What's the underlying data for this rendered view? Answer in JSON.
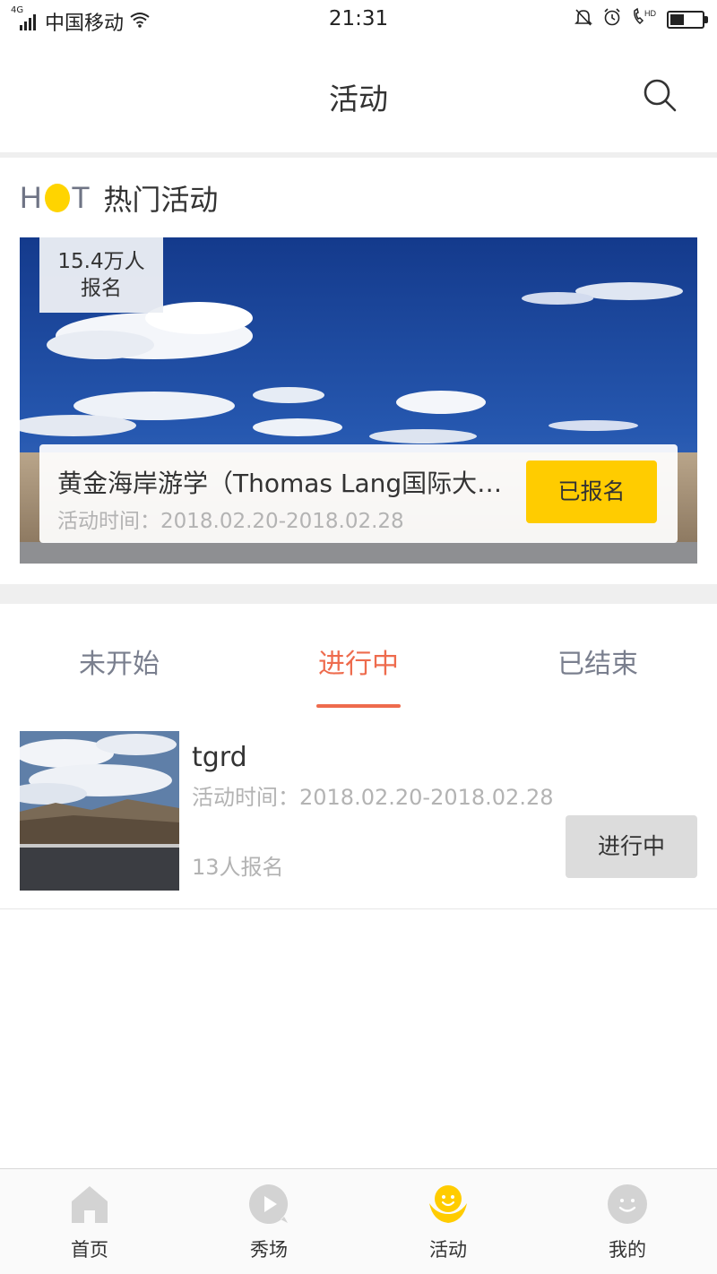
{
  "status_bar": {
    "network": "4G",
    "carrier": "中国移动",
    "time": "21:31",
    "battery_level": 0.45,
    "icons": [
      "signal-icon",
      "wifi-icon",
      "mute-bell-icon",
      "alarm-icon",
      "hd-call-icon",
      "battery-icon"
    ]
  },
  "header": {
    "title": "活动",
    "search_icon": "search-icon"
  },
  "hot": {
    "logo": {
      "left": "H",
      "right": "T"
    },
    "title": "热门活动",
    "banner": {
      "badge_count": "15.4万人",
      "badge_label": "报名",
      "name": "黄金海岸游学（Thomas Lang国际大…",
      "time": "活动时间：2018.02.20-2018.02.28",
      "button": "已报名"
    }
  },
  "tabs": {
    "not_started": "未开始",
    "ongoing": "进行中",
    "ended": "已结束",
    "active": "ongoing",
    "active_color": "#ee6b4d"
  },
  "activities": [
    {
      "name": "tgrd",
      "time": "活动时间：2018.02.20-2018.02.28",
      "count": "13人报名",
      "button": "进行中"
    }
  ],
  "tabbar": {
    "items": [
      {
        "label": "首页",
        "icon": "home-icon",
        "active": false
      },
      {
        "label": "秀场",
        "icon": "play-icon",
        "active": false
      },
      {
        "label": "活动",
        "icon": "activity-icon",
        "active": true
      },
      {
        "label": "我的",
        "icon": "profile-icon",
        "active": false
      }
    ],
    "active_color": "#ffcc00",
    "inactive_color": "#d3d3d3"
  }
}
